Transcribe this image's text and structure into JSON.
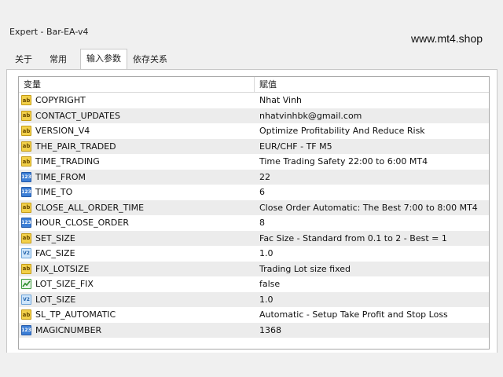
{
  "window": {
    "title": "Expert - Bar-EA-v4"
  },
  "watermark": "www.mt4.shop",
  "tabs": [
    {
      "label": "关于",
      "active": false
    },
    {
      "label": "常用",
      "active": false
    },
    {
      "label": "输入参数",
      "active": true
    },
    {
      "label": "依存关系",
      "active": false
    }
  ],
  "grid": {
    "columns": {
      "variable": "变量",
      "value": "赋值"
    },
    "rows": [
      {
        "name": "COPYRIGHT",
        "value": "Nhat Vinh",
        "type": "string",
        "icon": "ab"
      },
      {
        "name": "CONTACT_UPDATES",
        "value": "nhatvinhbk@gmail.com",
        "type": "string",
        "icon": "ab"
      },
      {
        "name": "VERSION_V4",
        "value": "Optimize Profitability And Reduce Risk",
        "type": "string",
        "icon": "ab"
      },
      {
        "name": "THE_PAIR_TRADED",
        "value": "EUR/CHF - TF M5",
        "type": "string",
        "icon": "ab"
      },
      {
        "name": "TIME_TRADING",
        "value": "Time Trading Safety 22:00 to 6:00 MT4",
        "type": "string",
        "icon": "ab"
      },
      {
        "name": "TIME_FROM",
        "value": "22",
        "type": "int",
        "icon": "123"
      },
      {
        "name": "TIME_TO",
        "value": "6",
        "type": "int",
        "icon": "123"
      },
      {
        "name": "CLOSE_ALL_ORDER_TIME",
        "value": "Close Order Automatic: The Best 7:00 to 8:00 MT4",
        "type": "string",
        "icon": "ab"
      },
      {
        "name": "HOUR_CLOSE_ORDER",
        "value": "8",
        "type": "int",
        "icon": "123"
      },
      {
        "name": "SET_SIZE",
        "value": "Fac Size - Standard from 0.1 to 2 - Best = 1",
        "type": "string",
        "icon": "ab"
      },
      {
        "name": "FAC_SIZE",
        "value": "1.0",
        "type": "double",
        "icon": "V2"
      },
      {
        "name": "FIX_LOTSIZE",
        "value": "Trading Lot size fixed",
        "type": "string",
        "icon": "ab"
      },
      {
        "name": "LOT_SIZE_FIX",
        "value": "false",
        "type": "bool",
        "icon": "bool"
      },
      {
        "name": "LOT_SIZE",
        "value": "1.0",
        "type": "double",
        "icon": "V2"
      },
      {
        "name": "SL_TP_AUTOMATIC",
        "value": "Automatic - Setup Take Profit and Stop Loss",
        "type": "string",
        "icon": "ab"
      },
      {
        "name": "MAGICNUMBER",
        "value": "1368",
        "type": "int",
        "icon": "123"
      }
    ]
  }
}
